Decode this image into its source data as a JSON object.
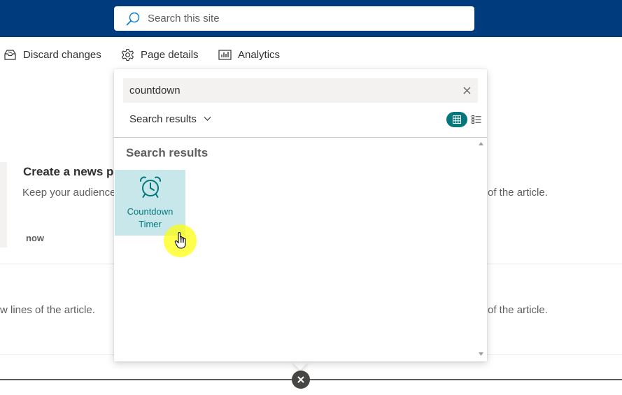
{
  "header": {
    "search_placeholder": "Search this site"
  },
  "command_bar": {
    "discard_label": "Discard changes",
    "page_details_label": "Page details",
    "analytics_label": "Analytics"
  },
  "background": {
    "news_title": "Create a news po",
    "news_description": "Keep your audience",
    "news_time": "now",
    "news_description_right": "of the article.",
    "row2_left": "w lines of the article.",
    "row2_right": "of the article."
  },
  "toolbox": {
    "search_value": "countdown",
    "filter_label": "Search results",
    "results_heading": "Search results",
    "results": [
      {
        "label": "Countdown Timer",
        "icon": "alarm-clock-icon"
      }
    ],
    "view_mode": "grid"
  },
  "colors": {
    "suite_bar": "#003b7e",
    "accent_teal": "#03787c",
    "tile_selected": "#c7e7ea",
    "cursor_highlight": "#ffff00"
  }
}
